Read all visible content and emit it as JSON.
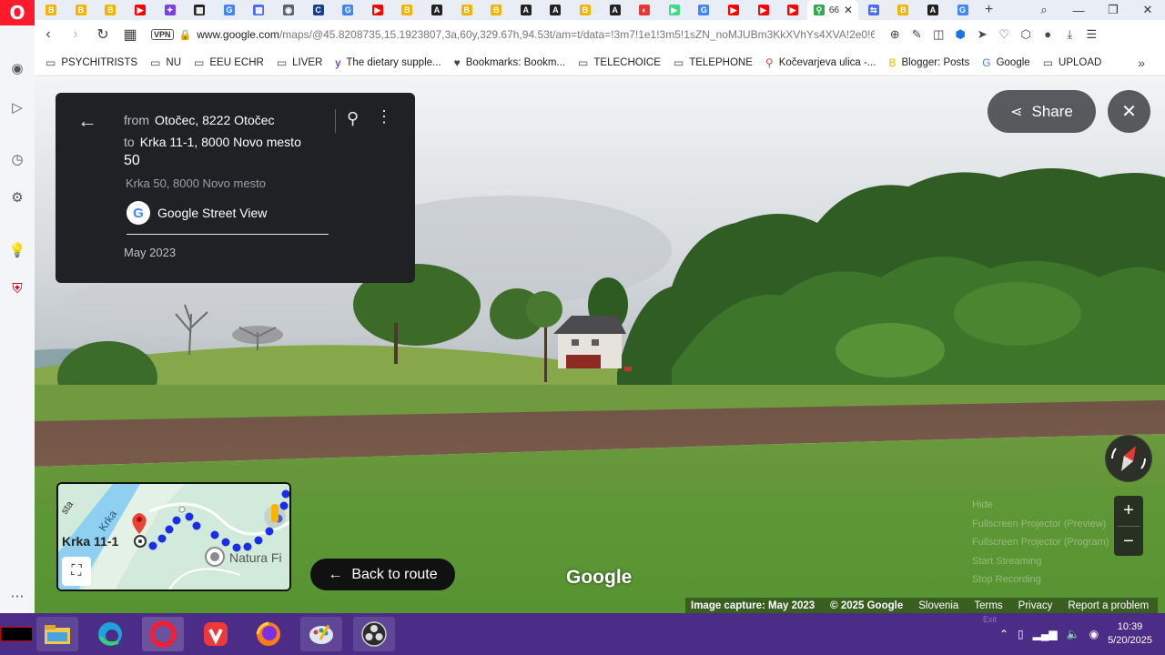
{
  "browser": {
    "active_tab_title": "66",
    "url_host": "www.google.com",
    "url_path": "/maps/@45.8208735,15.1923807,3a,60y,329.67h,94.53t/am=t/data=!3m7!1e1!3m5!1sZN_noMJUBm3KkXVhYs4XVA!2e0!6s",
    "vpn_label": "VPN",
    "new_tab_label": "+",
    "tab_favicons": [
      {
        "color": "#f4b400",
        "glyph": "B"
      },
      {
        "color": "#f4b400",
        "glyph": "B"
      },
      {
        "color": "#f4b400",
        "glyph": "B"
      },
      {
        "color": "#ff0000",
        "glyph": "▶"
      },
      {
        "color": "#7b3fe4",
        "glyph": "✦"
      },
      {
        "color": "#222222",
        "glyph": "▦"
      },
      {
        "color": "#4285f4",
        "glyph": "G"
      },
      {
        "color": "#4a6cf7",
        "glyph": "▦"
      },
      {
        "color": "#5f6368",
        "glyph": "◉"
      },
      {
        "color": "#1a3f8f",
        "glyph": "C"
      },
      {
        "color": "#4285f4",
        "glyph": "G"
      },
      {
        "color": "#ff0000",
        "glyph": "▶"
      },
      {
        "color": "#f4b400",
        "glyph": "B"
      },
      {
        "color": "#222222",
        "glyph": "A"
      },
      {
        "color": "#f4b400",
        "glyph": "B"
      },
      {
        "color": "#f4b400",
        "glyph": "B"
      },
      {
        "color": "#222222",
        "glyph": "A"
      },
      {
        "color": "#222222",
        "glyph": "A"
      },
      {
        "color": "#f4b400",
        "glyph": "B"
      },
      {
        "color": "#222222",
        "glyph": "A"
      },
      {
        "color": "#e53935",
        "glyph": "◐"
      },
      {
        "color": "#3ddc84",
        "glyph": "▶"
      },
      {
        "color": "#4285f4",
        "glyph": "G"
      },
      {
        "color": "#ff0000",
        "glyph": "▶"
      },
      {
        "color": "#ff0000",
        "glyph": "▶"
      },
      {
        "color": "#ff0000",
        "glyph": "▶"
      }
    ],
    "tab_favicons_after": [
      {
        "color": "#4a6cf7",
        "glyph": "⇆"
      },
      {
        "color": "#f4b400",
        "glyph": "B"
      },
      {
        "color": "#222222",
        "glyph": "A"
      },
      {
        "color": "#4285f4",
        "glyph": "G"
      }
    ]
  },
  "bookmarks": [
    {
      "label": "PSYCHITRISTS",
      "icon": "folder"
    },
    {
      "label": "NU",
      "icon": "folder"
    },
    {
      "label": "EEU ECHR",
      "icon": "folder"
    },
    {
      "label": "LIVER",
      "icon": "folder"
    },
    {
      "label": "The dietary supple...",
      "icon": "yahoo"
    },
    {
      "label": "Bookmarks: Bookm...",
      "icon": "heart"
    },
    {
      "label": "TELECHOICE",
      "icon": "folder"
    },
    {
      "label": "TELEPHONE",
      "icon": "folder"
    },
    {
      "label": "Kočevarjeva ulica -...",
      "icon": "maps-pin"
    },
    {
      "label": "Blogger: Posts",
      "icon": "blogger"
    },
    {
      "label": "Google",
      "icon": "google"
    },
    {
      "label": "UPLOAD",
      "icon": "folder"
    }
  ],
  "streetview": {
    "from_label": "from",
    "from_value": "Otočec, 8222 Otočec",
    "to_label": "to",
    "to_value": "Krka 11-1, 8000 Novo mesto",
    "number": "50",
    "address": "Krka 50, 8000 Novo mesto",
    "provider": "Google Street View",
    "capture_date": "May 2023",
    "share_label": "Share",
    "back_to_route": "Back to route",
    "watermark": "Google",
    "minimap": {
      "river_label": "Krka",
      "river_label2": "sta",
      "place_label": "Krka 11-1",
      "poi_label": "Natura Fi"
    },
    "obs_menu": [
      "Hide",
      "Fullscreen Projector (Preview)",
      "Fullscreen Projector (Program)",
      "Start Streaming",
      "Stop Recording"
    ],
    "footer": {
      "image_capture": "Image capture: May 2023",
      "copyright": "© 2025 Google",
      "country": "Slovenia",
      "terms": "Terms",
      "privacy": "Privacy",
      "report": "Report a problem"
    }
  },
  "taskbar": {
    "time": "10:39",
    "date": "5/20/2025",
    "exit_label": "Exit"
  }
}
